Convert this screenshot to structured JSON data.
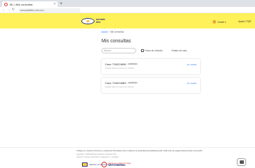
{
  "browser": {
    "tab_title": "ML | Mis consultas",
    "tab_close": "×",
    "new_tab": "+",
    "url": "mercadolibre.com.co/...",
    "icons": [
      "back-icon",
      "forward-icon",
      "reload-icon",
      "lock-icon"
    ]
  },
  "header": {
    "logo_line1": "mercado",
    "logo_line2": "libre",
    "user_name": "Camilo",
    "user_caret": "▾",
    "help_label": "Ayuda / PQR",
    "colors": {
      "bar": "#fff159",
      "brand": "#2d3277",
      "link": "#3483fa"
    }
  },
  "breadcrumb": {
    "parent": "Ayuda",
    "separator": ">",
    "current": "Mis consultas"
  },
  "page": {
    "title": "Mis consultas",
    "search_placeholder": "Buscar",
    "filter_date": "Fecha de creación",
    "filter_status": "Estado de caso"
  },
  "cases": [
    {
      "title": "Caso 734524896",
      "badge": "CERRADO",
      "subtitle": "Creado hace 8 meses por Camilo",
      "action": "Ver detalle"
    },
    {
      "title": "Caso 734524883",
      "badge": "CERRADO",
      "subtitle": "Creado hace 8 meses por Camilo",
      "action": "Ver detalle"
    }
  ],
  "footer": {
    "links": "Trabaja con nosotros   Términos y condiciones   Privacidad   Cómo cuidamos la privacidad   Accesibilidad   Ayuda / PQR   Libro de quejas   Defensoría del consumidor",
    "copyright": "Copyright © 1999-2024 MercadoLibre Colombia LTDA.",
    "address": "Carrera 17 Número 93-09 Piso 3, Bogotá D.C., Colombia",
    "badge1_text": "Industria y Comercio SUPERINTENDENCIA",
    "badge2_line1": "Marca en no debe ser ilegal",
    "badge2_line2": "NO A LA PIRATERÍA"
  }
}
